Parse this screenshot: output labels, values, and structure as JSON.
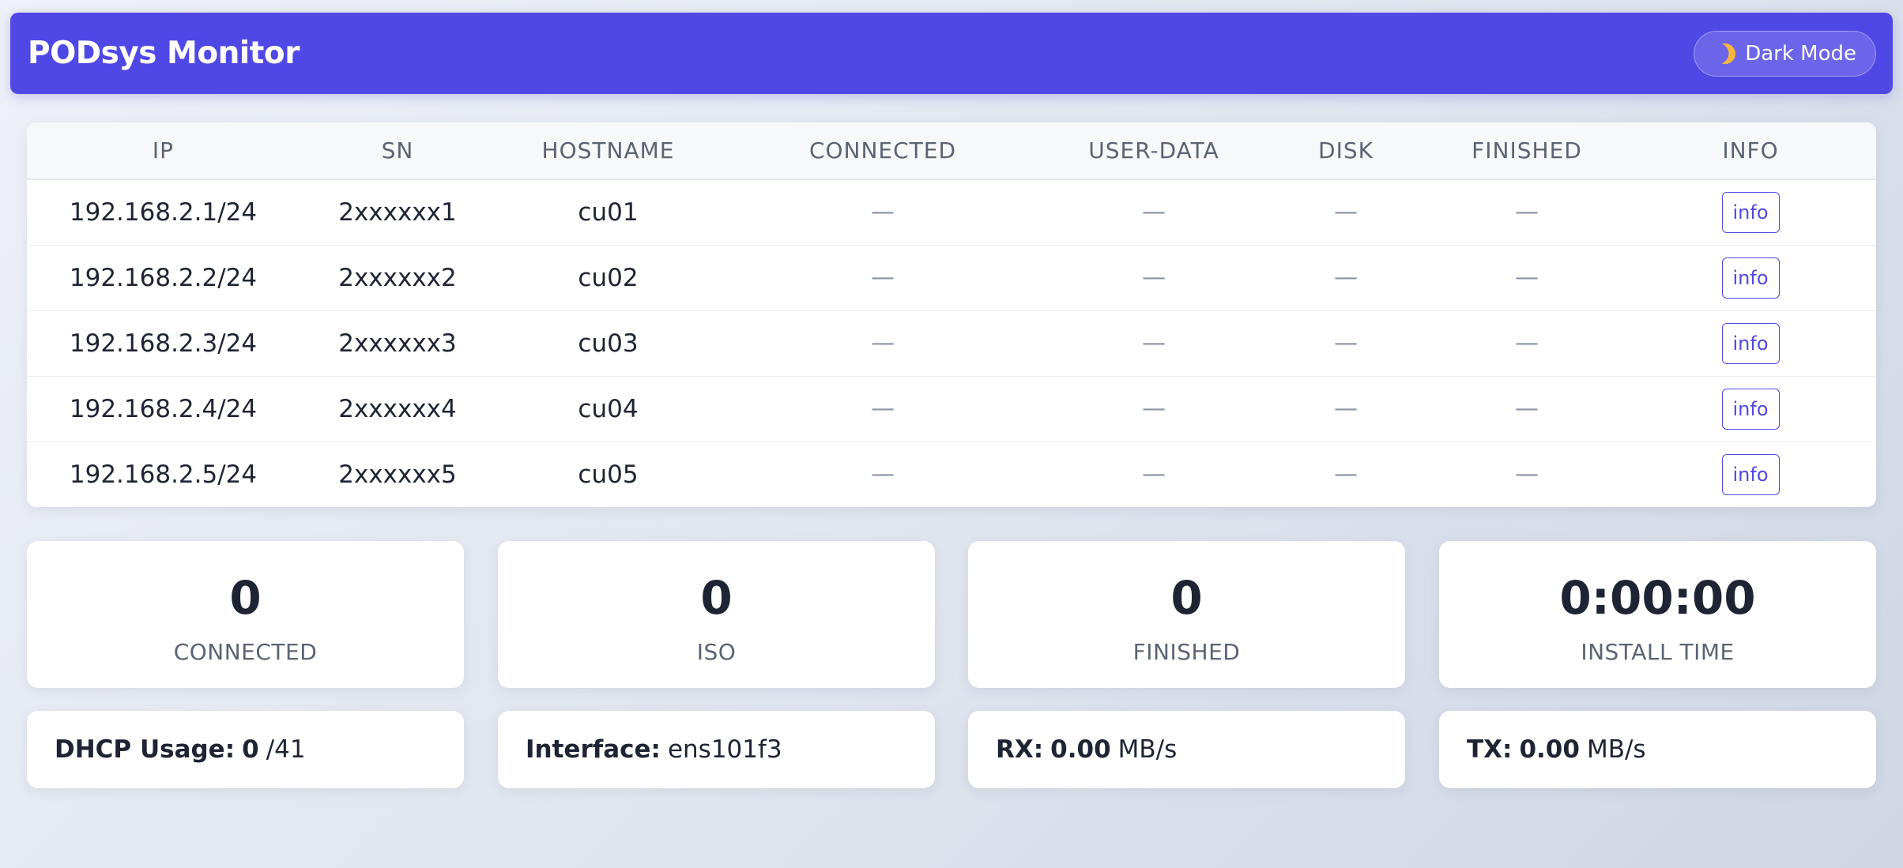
{
  "header": {
    "title": "PODsys Monitor",
    "theme_toggle_label": "Dark Mode"
  },
  "table": {
    "columns": [
      "IP",
      "SN",
      "HOSTNAME",
      "CONNECTED",
      "USER-DATA",
      "DISK",
      "FINISHED",
      "INFO"
    ],
    "rows": [
      {
        "ip": "192.168.2.1/24",
        "sn": "2xxxxxx1",
        "hostname": "cu01",
        "connected": "—",
        "user_data": "—",
        "disk": "—",
        "finished": "—",
        "info": "info"
      },
      {
        "ip": "192.168.2.2/24",
        "sn": "2xxxxxx2",
        "hostname": "cu02",
        "connected": "—",
        "user_data": "—",
        "disk": "—",
        "finished": "—",
        "info": "info"
      },
      {
        "ip": "192.168.2.3/24",
        "sn": "2xxxxxx3",
        "hostname": "cu03",
        "connected": "—",
        "user_data": "—",
        "disk": "—",
        "finished": "—",
        "info": "info"
      },
      {
        "ip": "192.168.2.4/24",
        "sn": "2xxxxxx4",
        "hostname": "cu04",
        "connected": "—",
        "user_data": "—",
        "disk": "—",
        "finished": "—",
        "info": "info"
      },
      {
        "ip": "192.168.2.5/24",
        "sn": "2xxxxxx5",
        "hostname": "cu05",
        "connected": "—",
        "user_data": "—",
        "disk": "—",
        "finished": "—",
        "info": "info"
      }
    ]
  },
  "stats": [
    {
      "value": "0",
      "label": "CONNECTED"
    },
    {
      "value": "0",
      "label": "ISO"
    },
    {
      "value": "0",
      "label": "FINISHED"
    },
    {
      "value": "0:00:00",
      "label": "INSTALL TIME"
    }
  ],
  "info_cards": {
    "dhcp": {
      "label": "DHCP Usage:",
      "value": "0",
      "suffix": "/41"
    },
    "interface": {
      "label": "Interface:",
      "value": "ens101f3"
    },
    "rx": {
      "label": "RX:",
      "value": "0.00",
      "unit": "MB/s"
    },
    "tx": {
      "label": "TX:",
      "value": "0.00",
      "unit": "MB/s"
    }
  },
  "colors": {
    "accent": "#5048e5",
    "background": "#e4e8f0",
    "card": "#ffffff",
    "text": "#1e2433",
    "muted": "#5b6373"
  },
  "icons": {
    "theme_toggle": "moon-icon"
  }
}
